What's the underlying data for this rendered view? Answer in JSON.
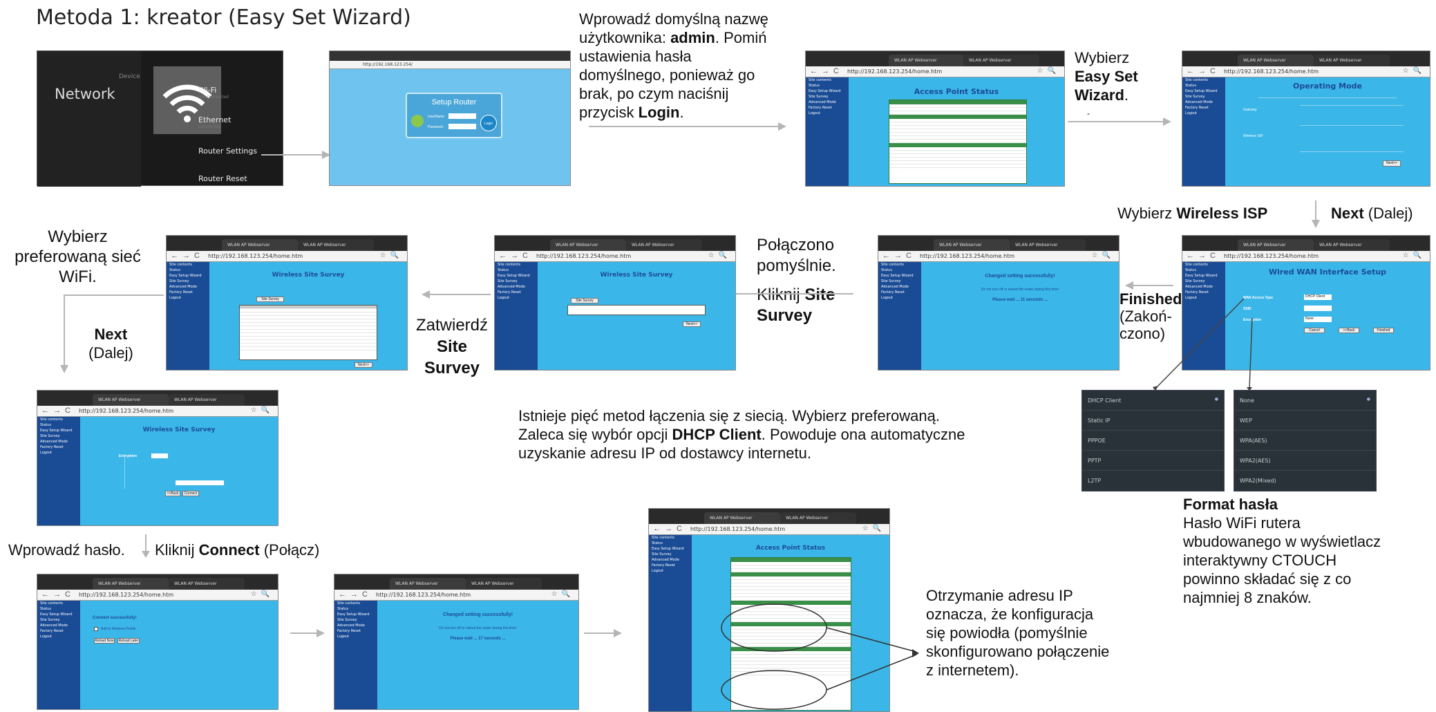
{
  "title": "Metoda 1: kreator (Easy Set Wizard)",
  "captions": {
    "c1_line1": "Wprowadź domyślną nazwę",
    "c1_line2_pre": "użytkownika: ",
    "c1_line2_bold": "admin",
    "c1_line2_post": ". Pomiń",
    "c1_line3": "ustawienia hasła",
    "c1_line4": "domyślnego, ponieważ go",
    "c1_line5": "brak, po czym naciśnij",
    "c1_line6_pre": "przycisk ",
    "c1_line6_bold": "Login",
    "c1_line6_post": ".",
    "c2_line1": "Wybierz",
    "c2_bold1": "Easy Set",
    "c2_bold2": "Wizard",
    "c2_post": ".",
    "c2_dash": "-",
    "c3_pre": "Wybierz ",
    "c3_bold": "Wireless ISP",
    "c4_bold": "Next",
    "c4_post": " (Dalej)",
    "c5_bold": "Finished",
    "c5_l2": "(Zakoń-",
    "c5_l3": "czono)",
    "c6_l1": "Połączono",
    "c6_l2": "pomyślnie.",
    "c6_l3_pre": "Kliknij ",
    "c6_l3_bold": "Site",
    "c6_l4_bold": "Survey",
    "c7_l1": "Zatwierdź",
    "c7_b1": "Site",
    "c7_b2": "Survey",
    "c8_l1": "Wybierz",
    "c8_l2": "preferowaną sieć",
    "c8_l3": "WiFi.",
    "c9_bold": "Next",
    "c9_l2": "(Dalej)",
    "c10_l1": "Istnieje pięć metod łączenia się z siecią. Wybierz preferowaną.",
    "c10_l2_pre": "Zaleca się wybór opcji ",
    "c10_l2_bold": "DHCP Client",
    "c10_l2_post": ". Powoduje ona automatyczne",
    "c10_l3": "uzyskanie adresu IP od dostawcy internetu.",
    "c11_bold": "Format hasła",
    "c11_l1": "Hasło WiFi rutera",
    "c11_l2": "wbudowanego w wyświetlacz",
    "c11_l3": "interaktywny CTOUCH",
    "c11_l4": "powinno składać się z co",
    "c11_l5": "najmniej 8 znaków.",
    "c12": "Wprowadź hasło.",
    "c13_pre": "Kliknij ",
    "c13_bold": "Connect",
    "c13_post": " (Połącz)",
    "c14_l1": "Otrzymanie adresu IP",
    "c14_l2": "oznacza, że konfiguracja",
    "c14_l3": "się powiodła (pomyślnie",
    "c14_l4": "skonfigurowano połączenie",
    "c14_l5": "z internetem)."
  },
  "android": {
    "device": "Device",
    "network": "Network",
    "items": [
      {
        "label": "Wi-Fi",
        "sub": "Not connected"
      },
      {
        "label": "Ethernet",
        "sub": "Connected"
      },
      {
        "label": "Router Settings",
        "sub": ""
      },
      {
        "label": "Router Reset",
        "sub": ""
      }
    ]
  },
  "login": {
    "heading": "Setup Router",
    "username": "UserName",
    "password": "Password",
    "button": "Login",
    "url": "http://192.168.123.254/"
  },
  "browser": {
    "tab1": "WLAN AP Webserver",
    "tab2": "WLAN AP Webserver",
    "url": "http://192.168.123.254/home.htm",
    "side": [
      "Site contents",
      "Status",
      "Easy Setup Wizard",
      "Site Survey",
      "Advanced Mode",
      "Factory Reset",
      "Logout"
    ]
  },
  "pages": {
    "status": "Access Point Status",
    "opmode": "Operating Mode",
    "gateway": "Gateway",
    "wisp": "Wireless ISP",
    "next": "Next>>",
    "survey": "Wireless Site Survey",
    "survey_btn": "Site Survey",
    "changed": "Changed setting successfully!",
    "donot": "Do not turn off or reboot the router during this time!",
    "wait11": "Please wait ... 11 seconds ...",
    "wait17": "Please wait ... 17 seconds ...",
    "wan": "Wired WAN Interface Setup",
    "wan_type": "WAN Access Type",
    "wan_val": "DHCP Client",
    "ssid_lbl": "SSID",
    "encrypt_lbl": "Encryption",
    "encrypt_val": "None",
    "cancel": "Cancel",
    "back": "<<Back",
    "finished": "Finished",
    "connect_ok": "Connect successfully!",
    "add_profile": "Add to Wireless Profile",
    "reload": "Reload Now",
    "reload_later": "Reload Later",
    "connect": "Connect"
  },
  "dropdowns": {
    "wan": [
      "DHCP Client",
      "Static IP",
      "PPPOE",
      "PPTP",
      "L2TP"
    ],
    "enc": [
      "None",
      "WEP",
      "WPA(AES)",
      "WPA2(AES)",
      "WPA2(Mixed)"
    ]
  }
}
